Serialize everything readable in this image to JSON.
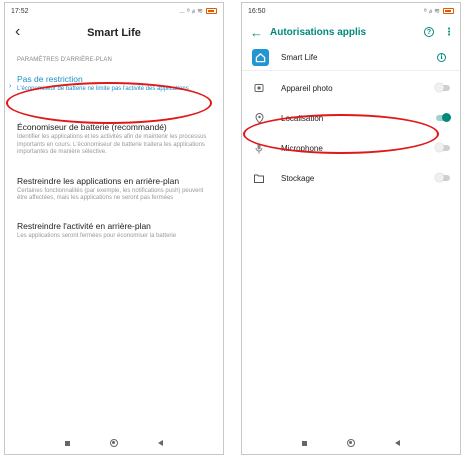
{
  "left_phone": {
    "status_time": "17:52",
    "status_icons": "... ⁸ ᵢₗₗ ≋",
    "title": "Smart Life",
    "section_header": "PARAMÈTRES D'ARRIÈRE-PLAN",
    "options": [
      {
        "title": "Pas de restriction",
        "desc": "L'économiseur de batterie ne limite pas l'activité des applications",
        "selected": true
      },
      {
        "title": "Économiseur de batterie (recommandé)",
        "desc": "Identifier les applications et les activités afin de maintenir les processus importants en cours. L'économiseur de batterie traitera les applications importantes de manière sélective.",
        "selected": false
      },
      {
        "title": "Restreindre les applications en arrière-plan",
        "desc": "Certaines fonctionnalités (par exemple, les notifications push) peuvent être affectées, mais les applications ne seront pas fermées",
        "selected": false
      },
      {
        "title": "Restreindre l'activité en arrière-plan",
        "desc": "Les applications seront fermées pour économiser la batterie",
        "selected": false
      }
    ]
  },
  "right_phone": {
    "status_time": "16:50",
    "status_icons": "⁸ ᵢₗₗ ≋",
    "title": "Autorisations applis",
    "help_label": "?",
    "more_label": "⋮",
    "info_label": "i",
    "app_name": "Smart Life",
    "permissions": [
      {
        "label": "Appareil photo",
        "icon": "camera-icon",
        "enabled": false
      },
      {
        "label": "Localisation",
        "icon": "location-icon",
        "enabled": true
      },
      {
        "label": "Microphone",
        "icon": "microphone-icon",
        "enabled": false
      },
      {
        "label": "Stockage",
        "icon": "folder-icon",
        "enabled": false
      }
    ]
  },
  "colors": {
    "accent_blue": "#1a8fc7",
    "accent_teal": "#00897b",
    "annotation_red": "#e01818",
    "app_icon_blue": "#2196d3"
  }
}
